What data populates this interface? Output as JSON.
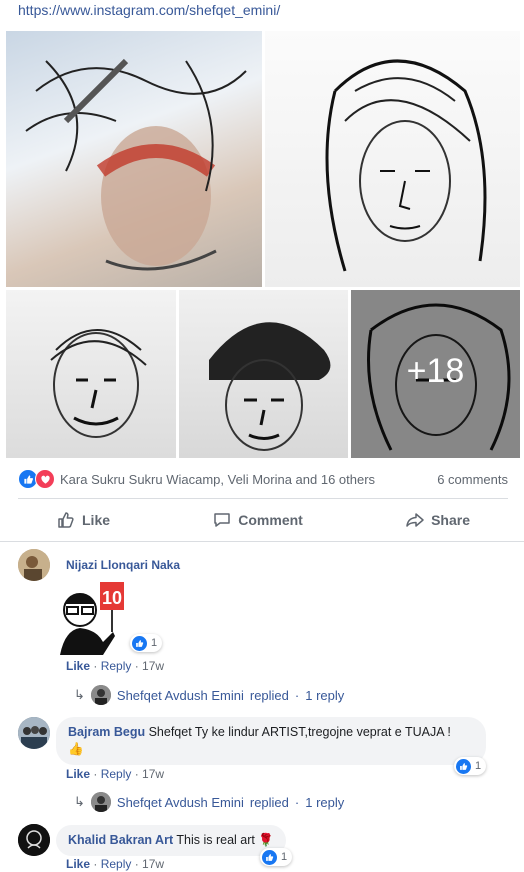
{
  "post": {
    "link_text": "https://www.instagram.com/shefqet_emini/",
    "more_photos": "+18",
    "reactions_text": "Kara Sukru Sukru Wiacamp, Veli Morina and 16 others",
    "comments_count": "6 comments"
  },
  "actions": {
    "like": "Like",
    "comment": "Comment",
    "share": "Share"
  },
  "colors": {
    "link": "#385898",
    "like_blue": "#1877f2",
    "love_red": "#f33e58",
    "muted": "#606770"
  },
  "comments": [
    {
      "author": "Nijazi Llonqari Naka",
      "sticker": "10",
      "reaction_count": "1",
      "like_label": "Like",
      "reply_label": "Reply",
      "time": "17w",
      "replied_author": "Shefqet Avdush Emini",
      "replied_word": "replied",
      "reply_count": "1 reply"
    },
    {
      "author": "Bajram Begu",
      "text": "Shefqet Ty ke lindur ARTIST,tregojne veprat e TUAJA !",
      "emoji": "👍",
      "reaction_count": "1",
      "like_label": "Like",
      "reply_label": "Reply",
      "time": "17w",
      "replied_author": "Shefqet Avdush Emini",
      "replied_word": "replied",
      "reply_count": "1 reply"
    },
    {
      "author": "Khalid Bakran Art",
      "text": "This is real art",
      "emoji": "🌹",
      "reaction_count": "1",
      "like_label": "Like",
      "reply_label": "Reply",
      "time": "17w"
    }
  ]
}
